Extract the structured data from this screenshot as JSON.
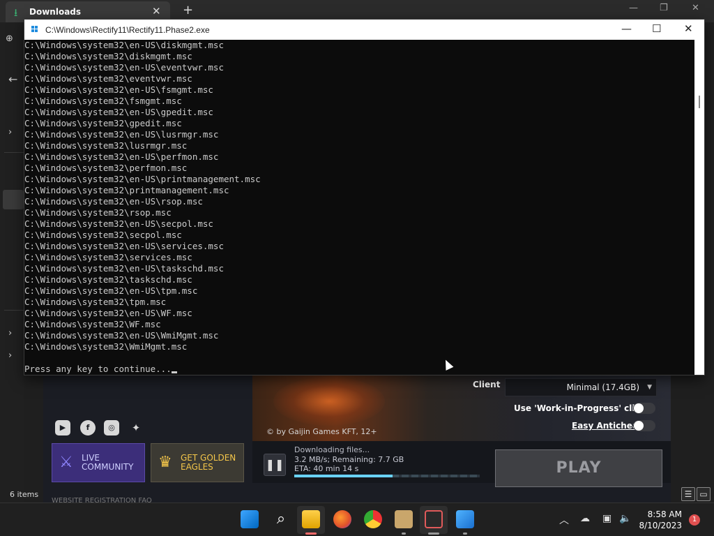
{
  "explorer": {
    "tab_title": "Downloads",
    "close_glyph": "✕",
    "new_tab_glyph": "+",
    "status": "6 items",
    "icons": [
      "download-icon",
      "back-arrow-icon",
      "chevron-right-icon"
    ]
  },
  "console": {
    "title": "C:\\Windows\\Rectify11\\Rectify11.Phase2.exe",
    "lines": [
      "C:\\Windows\\system32\\en-US\\diskmgmt.msc",
      "C:\\Windows\\system32\\diskmgmt.msc",
      "C:\\Windows\\system32\\en-US\\eventvwr.msc",
      "C:\\Windows\\system32\\eventvwr.msc",
      "C:\\Windows\\system32\\en-US\\fsmgmt.msc",
      "C:\\Windows\\system32\\fsmgmt.msc",
      "C:\\Windows\\system32\\en-US\\gpedit.msc",
      "C:\\Windows\\system32\\gpedit.msc",
      "C:\\Windows\\system32\\en-US\\lusrmgr.msc",
      "C:\\Windows\\system32\\lusrmgr.msc",
      "C:\\Windows\\system32\\en-US\\perfmon.msc",
      "C:\\Windows\\system32\\perfmon.msc",
      "C:\\Windows\\system32\\en-US\\printmanagement.msc",
      "C:\\Windows\\system32\\printmanagement.msc",
      "C:\\Windows\\system32\\en-US\\rsop.msc",
      "C:\\Windows\\system32\\rsop.msc",
      "C:\\Windows\\system32\\en-US\\secpol.msc",
      "C:\\Windows\\system32\\secpol.msc",
      "C:\\Windows\\system32\\en-US\\services.msc",
      "C:\\Windows\\system32\\services.msc",
      "C:\\Windows\\system32\\en-US\\taskschd.msc",
      "C:\\Windows\\system32\\taskschd.msc",
      "C:\\Windows\\system32\\en-US\\tpm.msc",
      "C:\\Windows\\system32\\tpm.msc",
      "C:\\Windows\\system32\\en-US\\WF.msc",
      "C:\\Windows\\system32\\WF.msc",
      "C:\\Windows\\system32\\en-US\\WmiMgmt.msc",
      "C:\\Windows\\system32\\WmiMgmt.msc",
      "",
      "Press any key to continue..."
    ],
    "minimize_glyph": "—",
    "maximize_glyph": "☐",
    "close_glyph": "✕"
  },
  "launcher": {
    "copyright": "© by Gaijin Games KFT, 12+",
    "social": [
      {
        "name": "youtube-icon",
        "glyph": "▶"
      },
      {
        "name": "facebook-icon",
        "glyph": "f"
      },
      {
        "name": "instagram-icon",
        "glyph": "◎"
      },
      {
        "name": "twitter-icon",
        "glyph": "🐦"
      }
    ],
    "live_community": "LIVE COMMUNITY",
    "golden_eagles": "GET GOLDEN EAGLES",
    "download_title": "Downloading files...",
    "download_speed": "3.2 MB/s; Remaining: 7.7 GB",
    "download_eta": "ETA: 40 min 14 s",
    "progress_fraction": 0.53,
    "play_label": "PLAY",
    "client_label": "Client",
    "client_value": "Minimal (17.4GB)",
    "wip_label": "Use 'Work-in-Progress' client",
    "anticheat_label": "Easy Anticheat",
    "footer_links": "WEBSITE     REGISTRATION     FAQ"
  },
  "taskbar": {
    "apps": [
      "windows-start-icon",
      "search-icon",
      "file-explorer-icon",
      "firefox-icon",
      "chrome-icon",
      "archive-icon",
      "game-launcher-icon",
      "rectify-icon"
    ],
    "time": "8:58 AM",
    "date": "8/10/2023",
    "notifications": "1",
    "tray": [
      "chevron-up-icon",
      "cloud-off-icon",
      "network-icon",
      "volume-icon"
    ]
  }
}
